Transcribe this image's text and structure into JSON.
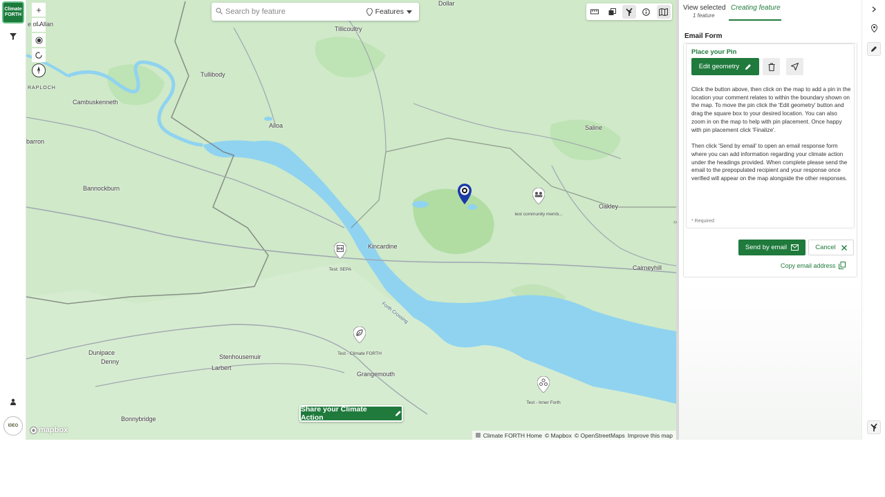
{
  "app": {
    "logo_text": "Climate FORTH"
  },
  "map": {
    "search_placeholder": "Search by feature",
    "features_label": "Features",
    "zoom_in": "+",
    "zoom_out": "−",
    "share_button": "Share your Climate Action",
    "mapbox_label": "mapbox",
    "attribution": [
      "Climate FORTH Home",
      "© Mapbox",
      "© OpenStreetMaps",
      "Improve this map"
    ],
    "places": [
      {
        "name": "Dollar"
      },
      {
        "name": "Tillicoultry"
      },
      {
        "name": "e of Allan"
      },
      {
        "name": "Tullibody"
      },
      {
        "name": "RAPLOCH"
      },
      {
        "name": "Cambuskenneth"
      },
      {
        "name": "Alloa"
      },
      {
        "name": "Saline"
      },
      {
        "name": "barron"
      },
      {
        "name": "Bannockburn"
      },
      {
        "name": "Oakley"
      },
      {
        "name": "Kincardine"
      },
      {
        "name": "Cairneyhill"
      },
      {
        "name": "Dunipace"
      },
      {
        "name": "Denny"
      },
      {
        "name": "Stenhousemuir"
      },
      {
        "name": "Larbert"
      },
      {
        "name": "Grangemouth"
      },
      {
        "name": "Bonnybridge"
      },
      {
        "name": "Forth Crossing"
      }
    ],
    "markers": [
      {
        "label": "test community memb...",
        "icon": "people-icon"
      },
      {
        "label": "Test: SEPA",
        "icon": "building-icon"
      },
      {
        "label": "Test - Climate FORTH",
        "icon": "leaf-icon"
      },
      {
        "label": "Test - Inner Forth",
        "icon": "cluster-icon"
      }
    ]
  },
  "panel": {
    "tab_view_selected": "View selected",
    "tab_view_selected_sub": "1 feature",
    "tab_creating": "Creating feature",
    "form_title": "Email Form",
    "place_pin_title": "Place your Pin",
    "edit_geometry_label": "Edit geometry",
    "description_p1": "Click the button above, then click on the map to add a pin in the location your comment relates to within the boundary shown on the map. To move the pin click the 'Edit geometry' button and drag the square box to your desired location. You can also zoom in on the map to help with pin placement. Once happy with pin placement click 'Finalize'.",
    "description_p2": "Then click 'Send by email' to open an email response form where you can add information regarding your climate action under the headings provided. When complete please send the email to the prepopulated recipient and your response once verified will appear on the map alongside the other responses.",
    "required_note": "* Required",
    "send_by_email": "Send by email",
    "cancel": "Cancel",
    "copy_email": "Copy email address"
  },
  "colors": {
    "brand_green": "#1f7a3c",
    "water": "#8fd3f0",
    "land": "#cfe9c9",
    "pin_active": "#1a3aa8"
  }
}
